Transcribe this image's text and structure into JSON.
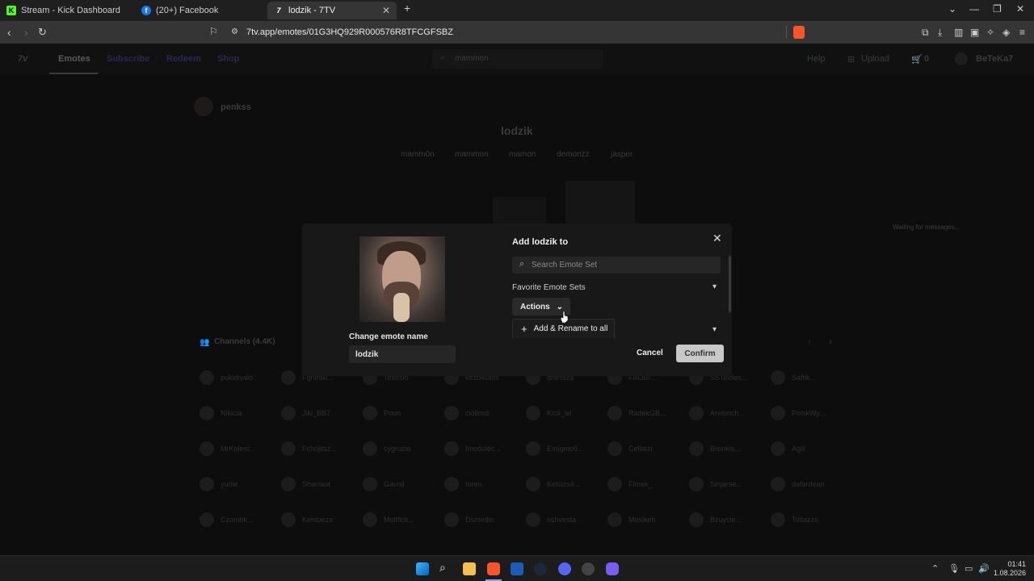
{
  "browser": {
    "tabs": [
      {
        "title": "Stream - Kick Dashboard",
        "favicon": "K",
        "color": "#53fc18"
      },
      {
        "title": "(20+) Facebook",
        "favicon": "f",
        "color": "#1877f2"
      },
      {
        "title": "lodzik - 7TV",
        "favicon": "7",
        "color": "#ffffff",
        "active": true
      }
    ],
    "url": "7tv.app/emotes/01G3HQ929R000576R8TFCGFSBZ"
  },
  "site": {
    "logo": "7v",
    "nav": [
      "Emotes",
      "Subscribe",
      "Redeem",
      "Shop"
    ],
    "search_value": "mammon",
    "right": {
      "help": "Help",
      "upload": "Upload",
      "cart_count": "0",
      "user": "BeTeKa7"
    },
    "owner": "penkss",
    "emote_name": "lodzik",
    "tags": [
      "mamm0n",
      "mammon",
      "mamon",
      "demonzz",
      "jasper"
    ],
    "channels_label": "Channels (4.4K)",
    "waiting": "Waiting for messages...",
    "channels": [
      [
        "pukidiyalo",
        "Fgneski...",
        "Tesosio",
        "kezolklass",
        "dnessza",
        "FillOBI...",
        "SSTeiden...",
        "Saftik..."
      ],
      [
        "Nikicia",
        "Jiki_BB7",
        "Poon",
        "ciollmdi",
        "Kicii_lel",
        "RadekGB...",
        "Arelonch...",
        "PolskWy..."
      ],
      [
        "MrKolesi...",
        "Fchojitsz...",
        "cygruzio",
        "Imodolec...",
        "Emigmo6...",
        "Cellatzr",
        "Bisinkis...",
        "Agill"
      ],
      [
        "yuriie",
        "Shanlast",
        "Gavnil",
        "Ioren",
        "Kelsizs4...",
        "Flmek_",
        "Sinjarse...",
        "dafardean"
      ],
      [
        "Czombk...",
        "Kentoeza",
        "Moltfick...",
        "Dsmedio",
        "ochvesta",
        "Mosikeh",
        "Bzuycie...",
        "Toltazzo"
      ]
    ]
  },
  "modal": {
    "title": "Add lodzik to",
    "search_placeholder": "Search Emote Set",
    "favorite_label": "Favorite Emote Sets",
    "actions_label": "Actions",
    "menu_item": "Add & Rename to all",
    "change_label": "Change emote name",
    "name_value": "lodzik",
    "cancel": "Cancel",
    "confirm": "Confirm"
  },
  "taskbar": {
    "time": "01:41",
    "date": "1.08.2026"
  }
}
